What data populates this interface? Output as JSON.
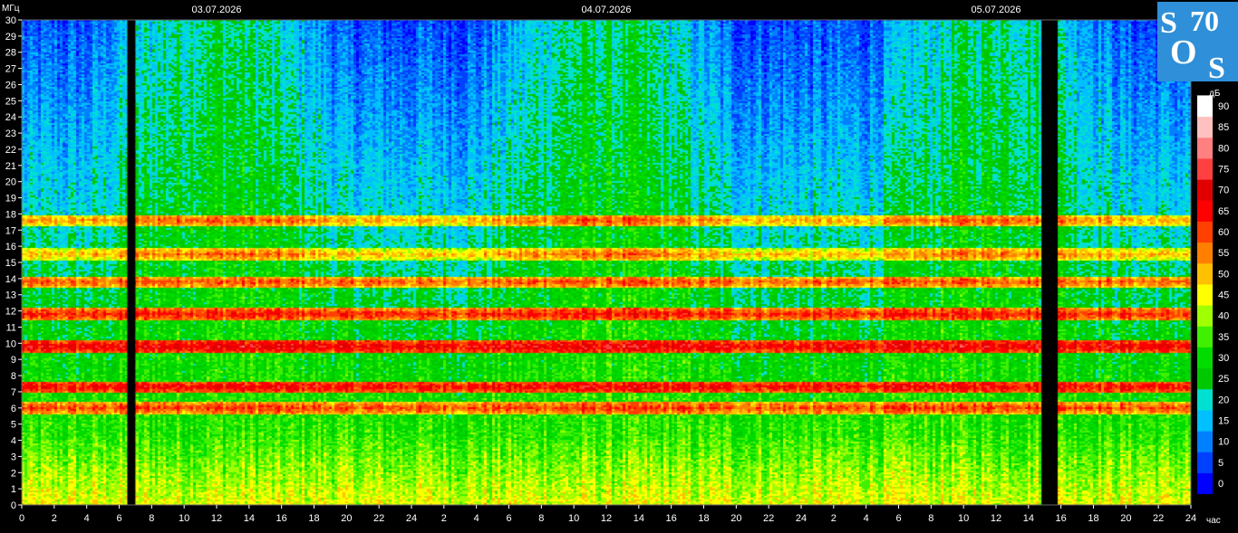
{
  "chart_data": {
    "type": "heatmap",
    "y_unit": "МГц",
    "x_unit": "час",
    "colorbar_unit": "дБ",
    "dates": [
      "03.07.2026",
      "04.07.2026",
      "05.07.2026"
    ],
    "x_tick_labels": [
      "0",
      "2",
      "4",
      "6",
      "8",
      "10",
      "12",
      "14",
      "16",
      "18",
      "20",
      "22",
      "24",
      "2",
      "4",
      "6",
      "8",
      "10",
      "12",
      "14",
      "16",
      "18",
      "20",
      "22",
      "24",
      "2",
      "4",
      "6",
      "8",
      "10",
      "12",
      "14",
      "16",
      "18",
      "20",
      "22",
      "24"
    ],
    "ylim": [
      0,
      30
    ],
    "y_tick_labels": [
      "0",
      "1",
      "2",
      "3",
      "4",
      "5",
      "6",
      "7",
      "8",
      "9",
      "10",
      "11",
      "12",
      "13",
      "14",
      "15",
      "16",
      "17",
      "18",
      "19",
      "20",
      "21",
      "22",
      "23",
      "24",
      "25",
      "26",
      "27",
      "28",
      "29",
      "30"
    ],
    "xlim_hours": [
      0,
      72
    ],
    "gaps_hours": [
      [
        6.5,
        7.0
      ],
      [
        62.8,
        63.8
      ]
    ],
    "bands_mhz": [
      {
        "freq": 17.6,
        "level": 60
      },
      {
        "freq": 15.5,
        "level": 58
      },
      {
        "freq": 13.8,
        "level": 60
      },
      {
        "freq": 11.8,
        "level": 65
      },
      {
        "freq": 9.8,
        "level": 70
      },
      {
        "freq": 7.3,
        "level": 68
      },
      {
        "freq": 6.0,
        "level": 62
      }
    ],
    "colorbar_ticks": [
      "0",
      "5",
      "10",
      "15",
      "20",
      "25",
      "30",
      "35",
      "40",
      "45",
      "50",
      "55",
      "60",
      "65",
      "70",
      "75",
      "80",
      "85",
      "90"
    ],
    "colorbar_colors": [
      "#0000ff",
      "#0040ff",
      "#0080ff",
      "#00c0ff",
      "#00e0d0",
      "#00c800",
      "#00dc00",
      "#40f000",
      "#a0ff00",
      "#ffff00",
      "#ffc000",
      "#ff8000",
      "#ff4000",
      "#ff0000",
      "#e00000",
      "#ff4040",
      "#ff8080",
      "#ffc0c0",
      "#ffffff"
    ]
  },
  "logo": {
    "text": [
      "S",
      "70",
      "O",
      "S"
    ],
    "bg_color": "#2f8fd8"
  }
}
